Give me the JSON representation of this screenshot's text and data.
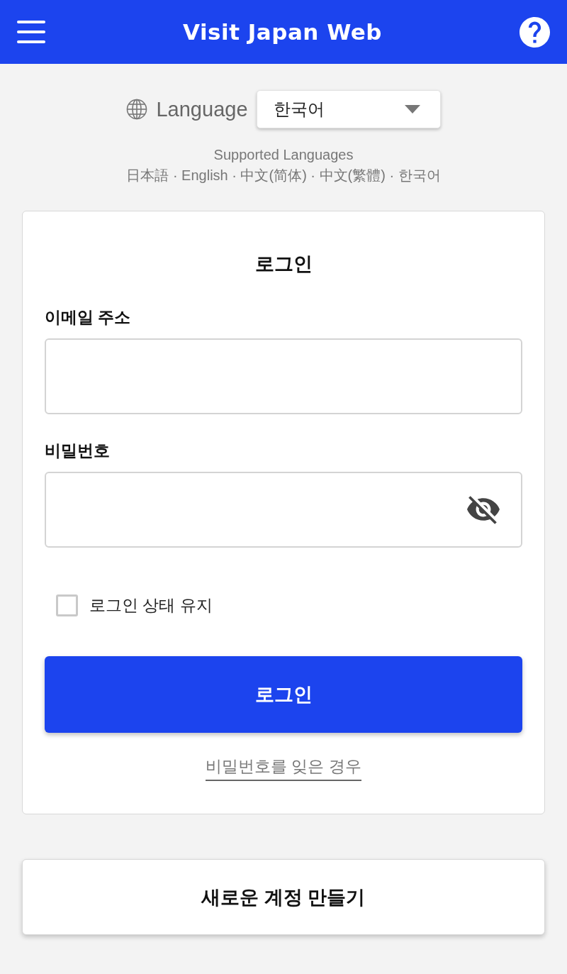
{
  "header": {
    "title": "Visit Japan Web"
  },
  "language": {
    "label": "Language",
    "value": "한국어"
  },
  "supported_languages": {
    "title": "Supported Languages",
    "list": "日本語 · English · 中文(简体) · 中文(繁體) · 한국어"
  },
  "login": {
    "title": "로그인",
    "fields": [
      {
        "label": "이메일 주소",
        "kind": "text"
      },
      {
        "label": "비밀번호",
        "kind": "password",
        "revealed": false
      }
    ],
    "remember": {
      "label": "로그인 상태 유지",
      "checked": false
    },
    "submit": "로그인",
    "forgot_link": "비밀번호를 잊은 경우"
  },
  "create_account": "새로운 계정 만들기"
}
